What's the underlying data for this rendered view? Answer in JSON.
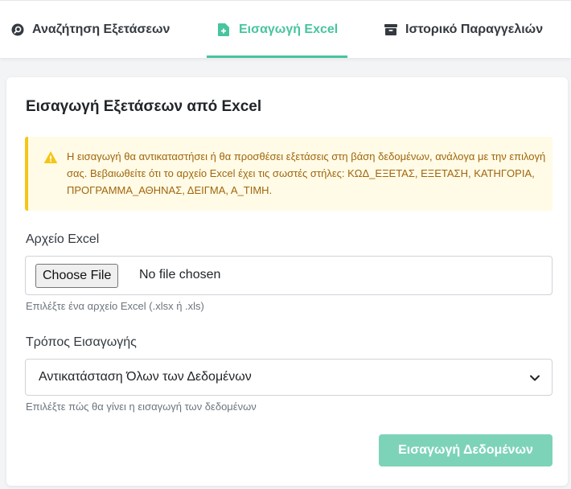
{
  "tabs": [
    {
      "label": "Αναζήτηση Εξετάσεων",
      "icon": "search-icon",
      "active": false
    },
    {
      "label": "Εισαγωγή Excel",
      "icon": "file-plus-icon",
      "active": true
    },
    {
      "label": "Ιστορικό Παραγγελιών",
      "icon": "archive-icon",
      "active": false
    }
  ],
  "card": {
    "title": "Εισαγωγή Εξετάσεων από Excel",
    "alert": {
      "icon": "warning-icon",
      "text": "Η εισαγωγή θα αντικαταστήσει ή θα προσθέσει εξετάσεις στη βάση δεδομένων, ανάλογα με την επιλογή σας. Βεβαιωθείτε ότι το αρχείο Excel έχει τις σωστές στήλες: ΚΩΔ_ΕΞΕΤΑΣ, ΕΞΕΤΑΣΗ, ΚΑΤΗΓΟΡΙΑ, ΠΡΟΓΡΑΜΜΑ_ΑΘΗΝΑΣ, ΔΕΙΓΜΑ, Α_ΤΙΜΗ."
    },
    "file_field": {
      "label": "Αρχείο Excel",
      "button_label": "Choose File",
      "status": "No file chosen",
      "help": "Επιλέξτε ένα αρχείο Excel (.xlsx ή .xls)"
    },
    "mode_field": {
      "label": "Τρόπος Εισαγωγής",
      "selected": "Αντικατάσταση Όλων των Δεδομένων",
      "help": "Επιλέξτε πώς θα γίνει η εισαγωγή των δεδομένων"
    },
    "submit_label": "Εισαγωγή Δεδομένων"
  },
  "colors": {
    "accent": "#48c49f",
    "button_disabled": "#7dd3b8",
    "alert_bg": "#fffbe6",
    "alert_border": "#f5c518",
    "alert_text": "#a0650d"
  }
}
